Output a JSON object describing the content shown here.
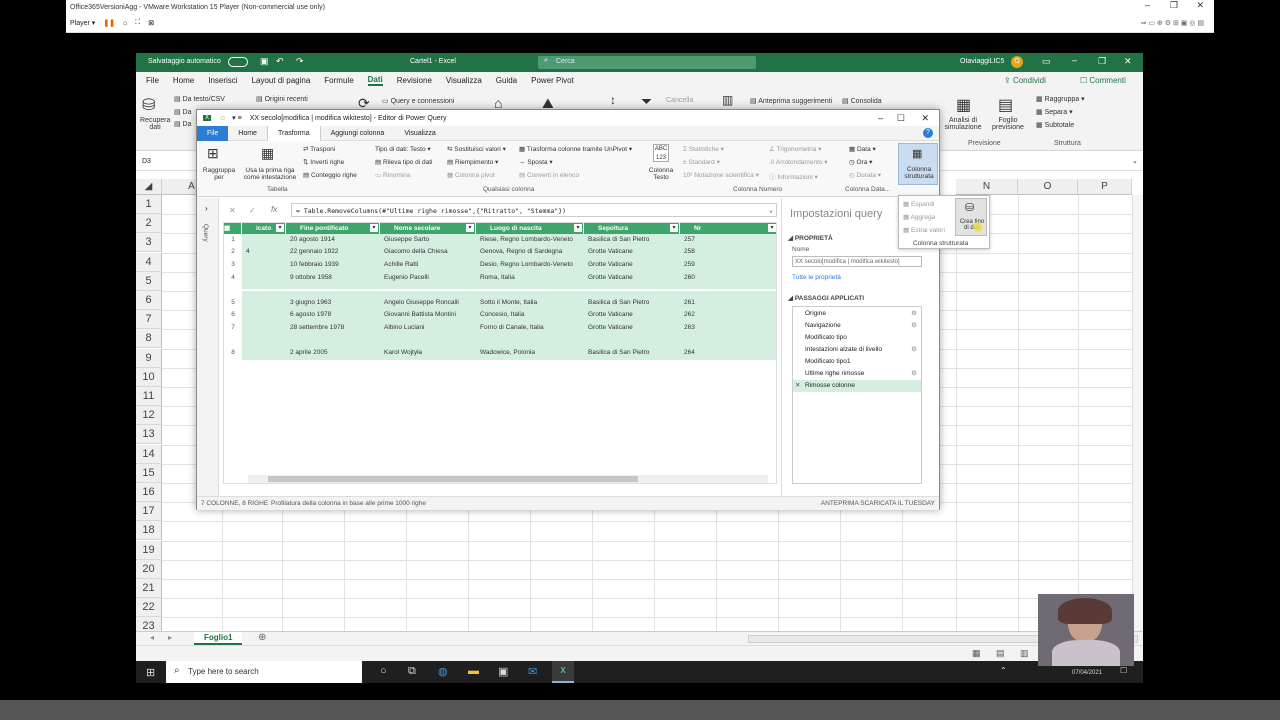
{
  "vm": {
    "title": "Office365VersioniAgg - VMware Workstation 15 Player (Non-commercial use only)",
    "player_label": "Player ▾"
  },
  "excel": {
    "autosave_label": "Salvataggio automatico",
    "doc_title": "Cartel1 - Excel",
    "search_placeholder": "Cerca",
    "user": "OtaviaggiLIC5",
    "user_initial": "O",
    "menu": [
      "File",
      "Home",
      "Inserisci",
      "Layout di pagina",
      "Formule",
      "Dati",
      "Revisione",
      "Visualizza",
      "Guida",
      "Power Pivot"
    ],
    "active_menu": "Dati",
    "share_label": "Condividi",
    "comments_label": "Commenti",
    "ribbon": {
      "recupera": "Recupera dati",
      "da_testo": "Da testo/CSV",
      "origini_recenti": "Origini recenti",
      "query_connessioni": "Query e connessioni",
      "cancella": "Cancella",
      "anteprima": "Anteprima suggerimenti",
      "consolida": "Consolida",
      "analisi": "Analisi di simulazione",
      "foglio": "Foglio previsione",
      "raggruppa": "Raggruppa",
      "separa": "Separa",
      "subtotale": "Subtotale",
      "previsione": "Previsione",
      "struttura": "Struttura"
    },
    "namebox": "D3",
    "columns": [
      "A",
      "N",
      "O",
      "P"
    ],
    "rows": [
      "1",
      "2",
      "3",
      "4",
      "5",
      "6",
      "7",
      "8",
      "9",
      "10",
      "11",
      "12",
      "13",
      "14",
      "15",
      "16",
      "17",
      "18",
      "19",
      "20",
      "21",
      "22",
      "23"
    ],
    "sheet_tab": "Foglio1"
  },
  "pq": {
    "title": "XX secolo[modifica | modifica wikitesto] - Editor di Power Query",
    "tabs": [
      "File",
      "Home",
      "Trasforma",
      "Aggiungi colonna",
      "Visualizza"
    ],
    "active_tab": "Trasforma",
    "ribbon": {
      "raggruppa": "Raggruppa per",
      "usa_prima_riga": "Usa la prima riga come intestazione",
      "trasponi": "Trasponi",
      "inverti": "Inverti righe",
      "conteggio": "Conteggio righe",
      "tabella_group": "Tabella",
      "tipo_dati": "Tipo di dati: Testo",
      "rileva": "Rileva tipo di dati",
      "rinomina": "Rinomina",
      "sostituisci": "Sostituisci valori",
      "riempimento": "Riempimento",
      "colonna_pivot": "Colonna pivot",
      "trasforma_unpivot": "Trasforma colonne tramite UnPivot",
      "sposta": "Sposta",
      "converti": "Converti in elenco",
      "qualsiasi_group": "Qualsiasi colonna",
      "colonna_testo": "Colonna Testo",
      "statistiche": "Statistiche",
      "standard": "Standard",
      "notazione": "Notazione scientifica",
      "trigonometria": "Trigonometria",
      "arrotondamento": "Arrotondamento",
      "informazioni": "Informazioni",
      "numero_group": "Colonna Numero",
      "data": "Data",
      "ora": "Ora",
      "durata": "Durata",
      "data_group": "Colonna Data...",
      "strutturata": "Colonna strutturata"
    },
    "dropdown": {
      "espandi": "Espandi",
      "aggrega": "Aggrega",
      "estrai": "Estrai valori",
      "crea_tipo": "Crea tipo di dati",
      "footer": "Colonna strutturata"
    },
    "query_label": "Query",
    "formula": "= Table.RemoveColumns(#\"Ultime righe rimosse\",{\"Ritratto\", \"Stemma\"})",
    "headers": [
      "icato",
      "Fine pontificato",
      "Nome secolare",
      "Luogo di nascita",
      "Sepoltura",
      "Nr"
    ],
    "rows": [
      {
        "n": "1",
        "a": "",
        "b": "20 agosto 1914",
        "c": "Giuseppe Sarto",
        "d": "Riese, Regno Lombardo-Veneto",
        "e": "Basilica di San Pietro",
        "f": "257"
      },
      {
        "n": "2",
        "a": "4",
        "b": "22 gennaio 1922",
        "c": "Giacomo della Chiesa",
        "d": "Genova, Regno di Sardegna",
        "e": "Grotte Vaticane",
        "f": "258"
      },
      {
        "n": "3",
        "a": "",
        "b": "10 febbraio 1939",
        "c": "Achille Ratti",
        "d": "Desio, Regno Lombardo-Veneto",
        "e": "Grotte Vaticane",
        "f": "259"
      },
      {
        "n": "4",
        "a": "",
        "b": "9 ottobre 1958",
        "c": "Eugenio Pacelli",
        "d": "Roma, Italia",
        "e": "Grotte Vaticane",
        "f": "260"
      },
      {
        "n": "5",
        "a": "",
        "b": "3 giugno 1963",
        "c": "Angelo Giuseppe Roncalli",
        "d": "Sotto il Monte, Italia",
        "e": "Basilica di San Pietro",
        "f": "261"
      },
      {
        "n": "6",
        "a": "",
        "b": "6 agosto 1978",
        "c": "Giovanni Battista Montini",
        "d": "Concesio, Italia",
        "e": "Grotte Vaticane",
        "f": "262"
      },
      {
        "n": "7",
        "a": "",
        "b": "28 settembre 1978",
        "c": "Albino Luciani",
        "d": "Forno di Canale, Italia",
        "e": "Grotte Vaticane",
        "f": "263"
      },
      {
        "n": "8",
        "a": "",
        "b": "2 aprile 2005",
        "c": "Karol Wojtyła",
        "d": "Wadowice, Polonia",
        "e": "Basilica di San Pietro",
        "f": "264"
      }
    ],
    "settings": {
      "title": "Impostazioni query",
      "props_header": "PROPRIETÀ",
      "name_label": "Nome",
      "name_value": "XX secolo[modifica | modifica wikitesto]",
      "all_props": "Tutte le proprietà",
      "steps_header": "PASSAGGI APPLICATI",
      "steps": [
        "Origine",
        "Navigazione",
        "Modificato tipo",
        "Intestazioni alzate di livello",
        "Modificato tipo1",
        "Ultime righe rimosse",
        "Rimosse colonne"
      ]
    },
    "status_left": "7 COLONNE, 8 RIGHE",
    "status_mid": "Profilatura della colonna in base alle prime 1000 righe",
    "status_right": "ANTEPRIMA SCARICATA IL TUESDAY"
  },
  "taskbar": {
    "search_placeholder": "Type here to search",
    "date": "07/04/2021"
  },
  "colors": {
    "excel_green": "#217346",
    "pq_header_green": "#3ea66c",
    "pq_row_bg": "#d4efdf",
    "accent_blue": "#2b7cd3"
  }
}
